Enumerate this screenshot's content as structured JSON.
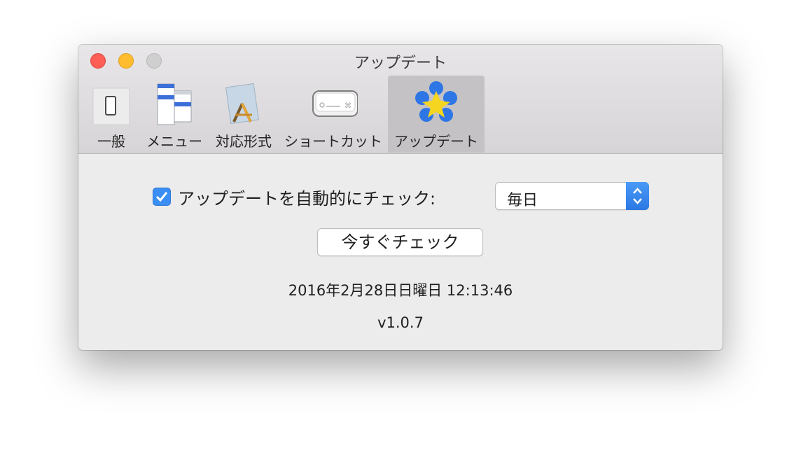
{
  "window": {
    "title": "アップデート",
    "controls": [
      "close-icon",
      "minimize-icon",
      "zoom-icon"
    ]
  },
  "toolbar": {
    "tabs": [
      {
        "label": "一般",
        "icon": "switch-icon",
        "selected": false
      },
      {
        "label": "メニュー",
        "icon": "menu-icon",
        "selected": false
      },
      {
        "label": "対応形式",
        "icon": "app-document-icon",
        "selected": false
      },
      {
        "label": "ショートカット",
        "icon": "keyboard-key-icon",
        "selected": false
      },
      {
        "label": "アップデート",
        "icon": "update-balls-icon",
        "selected": true
      }
    ]
  },
  "update": {
    "auto_check_label": "アップデートを自動的にチェック:",
    "auto_check_checked": true,
    "frequency_value": "毎日",
    "check_now_label": "今すぐチェック",
    "last_checked": "2016年2月28日日曜日 12:13:46",
    "version": "v1.0.7"
  },
  "colors": {
    "accent": "#3b8ef3",
    "close": "#fd5f57",
    "minimize": "#febc2e",
    "zoom": "#cfcfcf"
  }
}
